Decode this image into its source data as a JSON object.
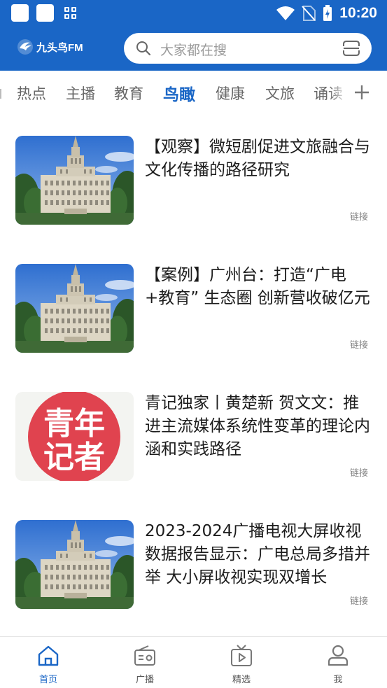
{
  "status_bar": {
    "time": "10:20",
    "icons": [
      "notification-square-icon",
      "notification-square-icon",
      "app-grid-icon",
      "wifi-icon",
      "no-sim-icon",
      "battery-charging-icon"
    ]
  },
  "header": {
    "app_name": "九头鸟FM",
    "logo_icon": "app-logo-icon",
    "search_placeholder": "大家都在搜",
    "search_icon": "search-icon",
    "scan_icon": "scan-icon"
  },
  "tabs": {
    "items": [
      "热点",
      "主播",
      "教育",
      "鸟瞰",
      "健康",
      "文旅",
      "诵读"
    ],
    "active": "鸟瞰",
    "add_icon": "plus-icon"
  },
  "articles": [
    {
      "title": "【观察】微短剧促进文旅融合与文化传播的路径研究",
      "thumbnail": "building-photo",
      "link_label": "链接"
    },
    {
      "title": "【案例】广州台：打造“广电+教育” 生态圈 创新营收破亿元",
      "thumbnail": "building-photo",
      "link_label": "链接"
    },
    {
      "title": "青记独家丨黄楚新 贺文文：推进主流媒体系统性变革的理论内涵和实践路径",
      "thumbnail": "qingnian-jizhe-logo",
      "thumbnail_text": [
        "青年",
        "记者"
      ],
      "link_label": "链接"
    },
    {
      "title": "2023-2024广播电视大屏收视数据报告显示：广电总局多措并举 大小屏收视实现双增长",
      "thumbnail": "building-photo",
      "link_label": "链接"
    }
  ],
  "bottom_nav": {
    "items": [
      {
        "label": "首页",
        "icon": "home-icon"
      },
      {
        "label": "广播",
        "icon": "radio-icon"
      },
      {
        "label": "精选",
        "icon": "tv-play-icon"
      },
      {
        "label": "我",
        "icon": "user-icon"
      }
    ],
    "active": "首页"
  },
  "colors": {
    "brand_blue": "#1a66c6",
    "logo_red": "#e0434f"
  }
}
